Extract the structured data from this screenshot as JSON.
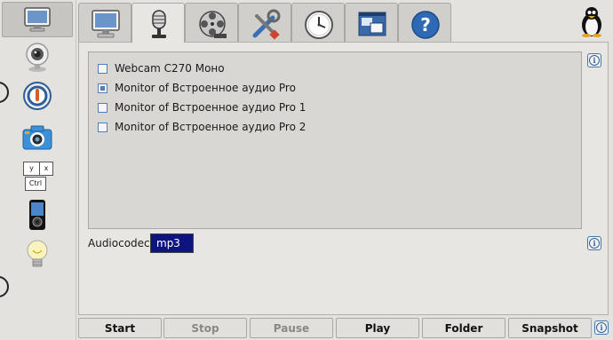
{
  "sidebar": {
    "items": [
      {
        "icon": "monitor-icon"
      },
      {
        "icon": "webcam-icon"
      },
      {
        "icon": "power-toggle-icon"
      },
      {
        "icon": "camera-icon"
      },
      {
        "icon": "keyboard-keys-icon",
        "keys": [
          "y",
          "x",
          "Ctrl"
        ]
      },
      {
        "icon": "media-player-icon"
      },
      {
        "icon": "lightbulb-icon"
      }
    ]
  },
  "tabs": [
    {
      "icon": "monitor-icon"
    },
    {
      "icon": "microphone-icon",
      "active": true
    },
    {
      "icon": "film-reel-icon"
    },
    {
      "icon": "tools-icon"
    },
    {
      "icon": "clock-icon"
    },
    {
      "icon": "windows-icon"
    },
    {
      "icon": "help-icon"
    }
  ],
  "devices": [
    {
      "label": "Webcam C270 Моно",
      "checked": false
    },
    {
      "label": "Monitor of Встроенное аудио Pro",
      "checked": true
    },
    {
      "label": "Monitor of Встроенное аудио Pro 1",
      "checked": false
    },
    {
      "label": "Monitor of Встроенное аудио Pro 2",
      "checked": false
    }
  ],
  "info_glyph": "i",
  "audiocodec": {
    "label": "Audiocodec",
    "value": "mp3"
  },
  "buttons": {
    "start": "Start",
    "stop": "Stop",
    "pause": "Pause",
    "play": "Play",
    "folder": "Folder",
    "snapshot": "Snapshot"
  },
  "colors": {
    "accent": "#0d1480",
    "checkbox": "#4f7fb5"
  }
}
